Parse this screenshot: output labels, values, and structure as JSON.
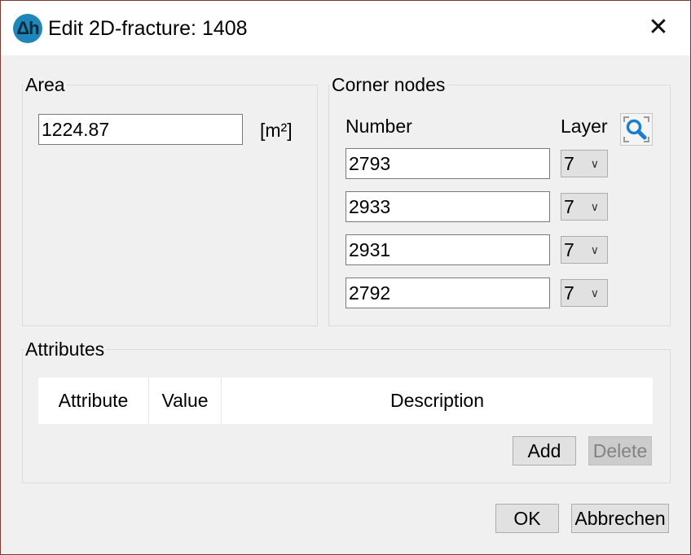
{
  "window": {
    "title": "Edit 2D-fracture: 1408",
    "app_icon_text": "Δh",
    "close_glyph": "✕"
  },
  "area": {
    "group_title": "Area",
    "value": "1224.87",
    "unit": "[m²]"
  },
  "corner_nodes": {
    "group_title": "Corner nodes",
    "number_header": "Number",
    "layer_header": "Layer",
    "find_icon": "magnifier-icon",
    "rows": [
      {
        "number": "2793",
        "layer": "7"
      },
      {
        "number": "2933",
        "layer": "7"
      },
      {
        "number": "2931",
        "layer": "7"
      },
      {
        "number": "2792",
        "layer": "7"
      }
    ]
  },
  "attributes": {
    "group_title": "Attributes",
    "columns": [
      "Attribute",
      "Value",
      "Description"
    ],
    "add_label": "Add",
    "delete_label": "Delete"
  },
  "footer": {
    "ok_label": "OK",
    "cancel_label": "Abbrechen"
  },
  "colors": {
    "accent": "#1e86b8",
    "icon_blue": "#1a7ed0"
  }
}
